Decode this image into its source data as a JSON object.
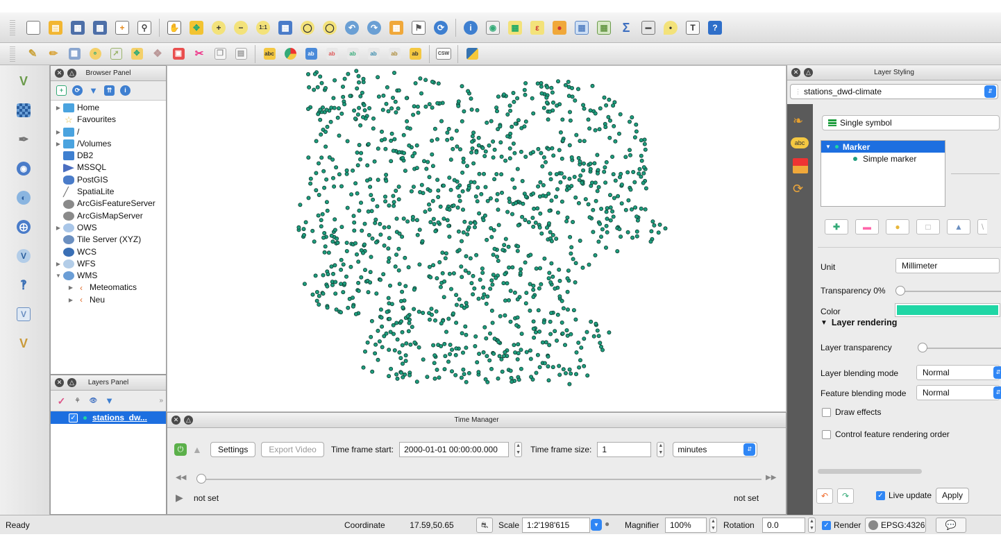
{
  "toolbar1": {
    "icons": [
      "new-project-icon",
      "open-project-icon",
      "save-project-icon",
      "save-as-icon",
      "new-print-composer-icon",
      "composer-manager-icon",
      "pan-icon",
      "pan-to-selection-icon",
      "zoom-in-icon",
      "zoom-out-icon",
      "zoom-native-icon",
      "zoom-full-icon",
      "zoom-to-selection-icon",
      "zoom-to-layer-icon",
      "zoom-last-icon",
      "zoom-next-icon",
      "new-map-view-icon",
      "bookmark-icon",
      "refresh-icon",
      "identify-icon",
      "select-features-icon",
      "select-by-expression-icon",
      "deselect-icon",
      "open-attribute-table-icon",
      "field-calculator-icon",
      "statistics-icon",
      "measure-icon",
      "map-tips-icon",
      "text-annotation-icon",
      "help-icon"
    ]
  },
  "toolbar2": {
    "icons": [
      "digitize-icon",
      "edit-pencil-icon",
      "save-edits-icon",
      "add-feature-icon",
      "add-polygon-icon",
      "move-feature-icon",
      "node-tool-icon",
      "delete-selected-icon",
      "cut-features-icon",
      "copy-features-icon",
      "paste-features-icon",
      "label-tool-icon",
      "diagram-tool-icon",
      "pin-labels-icon",
      "show-hide-labels-icon",
      "move-label-icon",
      "rotate-label-icon",
      "change-label-icon",
      "label-properties-icon",
      "csw-icon",
      "python-icon"
    ],
    "csw_label": "CSW"
  },
  "left_tools": [
    "add-vector-layer-icon",
    "add-raster-layer-icon",
    "add-spatialite-icon",
    "add-postgis-icon",
    "add-wms-icon",
    "add-wfs-icon",
    "add-wcs-icon",
    "add-delimited-text-icon",
    "new-shapefile-icon",
    "new-virtual-layer-icon"
  ],
  "browser_panel": {
    "title": "Browser Panel",
    "items": [
      {
        "label": "Home",
        "expandable": true,
        "icon": "folder-icon"
      },
      {
        "label": "Favourites",
        "expandable": false,
        "icon": "star-icon"
      },
      {
        "label": "/",
        "expandable": true,
        "icon": "folder-icon"
      },
      {
        "label": "/Volumes",
        "expandable": true,
        "icon": "folder-icon"
      },
      {
        "label": "DB2",
        "expandable": false,
        "icon": "db2-icon"
      },
      {
        "label": "MSSQL",
        "expandable": false,
        "icon": "mssql-icon"
      },
      {
        "label": "PostGIS",
        "expandable": false,
        "icon": "postgis-icon"
      },
      {
        "label": "SpatiaLite",
        "expandable": false,
        "icon": "spatialite-icon"
      },
      {
        "label": "ArcGisFeatureServer",
        "expandable": false,
        "icon": "arcgis-icon"
      },
      {
        "label": "ArcGisMapServer",
        "expandable": false,
        "icon": "arcgis-icon"
      },
      {
        "label": "OWS",
        "expandable": true,
        "icon": "ows-icon"
      },
      {
        "label": "Tile Server (XYZ)",
        "expandable": false,
        "icon": "tile-server-icon"
      },
      {
        "label": "WCS",
        "expandable": false,
        "icon": "wcs-icon"
      },
      {
        "label": "WFS",
        "expandable": true,
        "icon": "wfs-icon"
      },
      {
        "label": "WMS",
        "expandable": true,
        "expanded": true,
        "icon": "wms-icon"
      },
      {
        "label": "Meteomatics",
        "expandable": true,
        "icon": "wms-connection-icon",
        "child": true
      },
      {
        "label": "Neu",
        "expandable": true,
        "icon": "wms-connection-icon",
        "child": true
      }
    ]
  },
  "layers_panel": {
    "title": "Layers Panel",
    "layer": "stations_dw..."
  },
  "time_manager": {
    "title": "Time Manager",
    "settings": "Settings",
    "export_video": "Export Video",
    "frame_start_label": "Time frame start:",
    "frame_start_value": "2000-01-01 00:00:00.000",
    "frame_size_label": "Time frame size:",
    "frame_size_value": "1",
    "unit": "minutes",
    "left_status": "not set",
    "right_status": "not set"
  },
  "layer_styling": {
    "title": "Layer Styling",
    "layer": "stations_dwd-climate",
    "renderer": "Single symbol",
    "symbol_tree": {
      "root": "Marker",
      "child": "Simple marker"
    },
    "unit_label": "Unit",
    "unit_value": "Millimeter",
    "transparency_label": "Transparency 0%",
    "transparency": 0,
    "color_label": "Color",
    "symbol_color": "#1fd6a5",
    "layer_rendering": "Layer rendering",
    "layer_transparency_label": "Layer transparency",
    "layer_transparency": 0,
    "layer_blending_label": "Layer blending mode",
    "layer_blending_value": "Normal",
    "feature_blending_label": "Feature blending mode",
    "feature_blending_value": "Normal",
    "draw_effects": "Draw effects",
    "control_order": "Control feature rendering order",
    "live_update": "Live update",
    "apply": "Apply",
    "abc_label": "abc"
  },
  "status_bar": {
    "ready": "Ready",
    "coordinate_label": "Coordinate",
    "coordinate_value": "17.59,50.65",
    "scale_label": "Scale",
    "scale_value": "1:2'198'615",
    "magnifier_label": "Magnifier",
    "magnifier_value": "100%",
    "rotation_label": "Rotation",
    "rotation_value": "0.0",
    "render_label": "Render",
    "crs": "EPSG:4326"
  },
  "map": {
    "point_color": "#1e9e7e",
    "point_stroke": "#0d3b30",
    "point_count": 1150
  }
}
